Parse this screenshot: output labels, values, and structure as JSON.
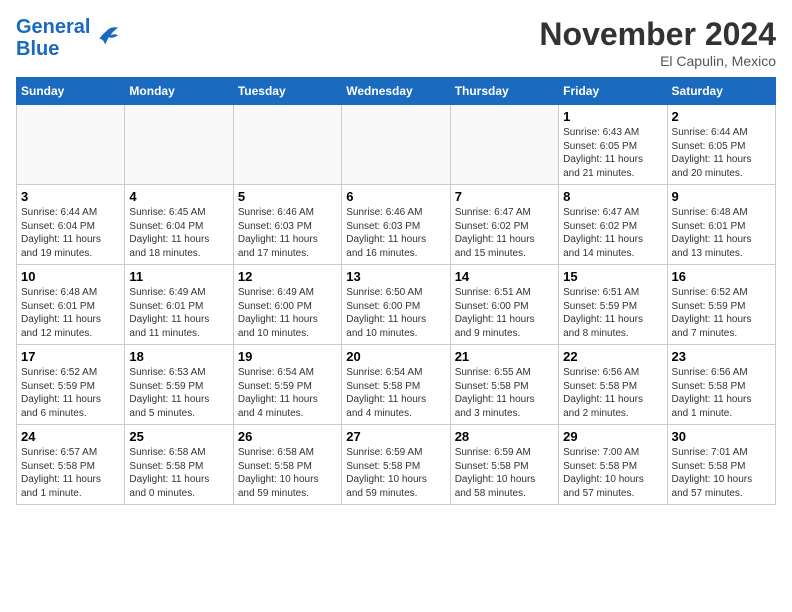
{
  "header": {
    "logo_line1": "General",
    "logo_line2": "Blue",
    "month": "November 2024",
    "location": "El Capulin, Mexico"
  },
  "weekdays": [
    "Sunday",
    "Monday",
    "Tuesday",
    "Wednesday",
    "Thursday",
    "Friday",
    "Saturday"
  ],
  "weeks": [
    [
      {
        "day": "",
        "info": ""
      },
      {
        "day": "",
        "info": ""
      },
      {
        "day": "",
        "info": ""
      },
      {
        "day": "",
        "info": ""
      },
      {
        "day": "",
        "info": ""
      },
      {
        "day": "1",
        "info": "Sunrise: 6:43 AM\nSunset: 6:05 PM\nDaylight: 11 hours\nand 21 minutes."
      },
      {
        "day": "2",
        "info": "Sunrise: 6:44 AM\nSunset: 6:05 PM\nDaylight: 11 hours\nand 20 minutes."
      }
    ],
    [
      {
        "day": "3",
        "info": "Sunrise: 6:44 AM\nSunset: 6:04 PM\nDaylight: 11 hours\nand 19 minutes."
      },
      {
        "day": "4",
        "info": "Sunrise: 6:45 AM\nSunset: 6:04 PM\nDaylight: 11 hours\nand 18 minutes."
      },
      {
        "day": "5",
        "info": "Sunrise: 6:46 AM\nSunset: 6:03 PM\nDaylight: 11 hours\nand 17 minutes."
      },
      {
        "day": "6",
        "info": "Sunrise: 6:46 AM\nSunset: 6:03 PM\nDaylight: 11 hours\nand 16 minutes."
      },
      {
        "day": "7",
        "info": "Sunrise: 6:47 AM\nSunset: 6:02 PM\nDaylight: 11 hours\nand 15 minutes."
      },
      {
        "day": "8",
        "info": "Sunrise: 6:47 AM\nSunset: 6:02 PM\nDaylight: 11 hours\nand 14 minutes."
      },
      {
        "day": "9",
        "info": "Sunrise: 6:48 AM\nSunset: 6:01 PM\nDaylight: 11 hours\nand 13 minutes."
      }
    ],
    [
      {
        "day": "10",
        "info": "Sunrise: 6:48 AM\nSunset: 6:01 PM\nDaylight: 11 hours\nand 12 minutes."
      },
      {
        "day": "11",
        "info": "Sunrise: 6:49 AM\nSunset: 6:01 PM\nDaylight: 11 hours\nand 11 minutes."
      },
      {
        "day": "12",
        "info": "Sunrise: 6:49 AM\nSunset: 6:00 PM\nDaylight: 11 hours\nand 10 minutes."
      },
      {
        "day": "13",
        "info": "Sunrise: 6:50 AM\nSunset: 6:00 PM\nDaylight: 11 hours\nand 10 minutes."
      },
      {
        "day": "14",
        "info": "Sunrise: 6:51 AM\nSunset: 6:00 PM\nDaylight: 11 hours\nand 9 minutes."
      },
      {
        "day": "15",
        "info": "Sunrise: 6:51 AM\nSunset: 5:59 PM\nDaylight: 11 hours\nand 8 minutes."
      },
      {
        "day": "16",
        "info": "Sunrise: 6:52 AM\nSunset: 5:59 PM\nDaylight: 11 hours\nand 7 minutes."
      }
    ],
    [
      {
        "day": "17",
        "info": "Sunrise: 6:52 AM\nSunset: 5:59 PM\nDaylight: 11 hours\nand 6 minutes."
      },
      {
        "day": "18",
        "info": "Sunrise: 6:53 AM\nSunset: 5:59 PM\nDaylight: 11 hours\nand 5 minutes."
      },
      {
        "day": "19",
        "info": "Sunrise: 6:54 AM\nSunset: 5:59 PM\nDaylight: 11 hours\nand 4 minutes."
      },
      {
        "day": "20",
        "info": "Sunrise: 6:54 AM\nSunset: 5:58 PM\nDaylight: 11 hours\nand 4 minutes."
      },
      {
        "day": "21",
        "info": "Sunrise: 6:55 AM\nSunset: 5:58 PM\nDaylight: 11 hours\nand 3 minutes."
      },
      {
        "day": "22",
        "info": "Sunrise: 6:56 AM\nSunset: 5:58 PM\nDaylight: 11 hours\nand 2 minutes."
      },
      {
        "day": "23",
        "info": "Sunrise: 6:56 AM\nSunset: 5:58 PM\nDaylight: 11 hours\nand 1 minute."
      }
    ],
    [
      {
        "day": "24",
        "info": "Sunrise: 6:57 AM\nSunset: 5:58 PM\nDaylight: 11 hours\nand 1 minute."
      },
      {
        "day": "25",
        "info": "Sunrise: 6:58 AM\nSunset: 5:58 PM\nDaylight: 11 hours\nand 0 minutes."
      },
      {
        "day": "26",
        "info": "Sunrise: 6:58 AM\nSunset: 5:58 PM\nDaylight: 10 hours\nand 59 minutes."
      },
      {
        "day": "27",
        "info": "Sunrise: 6:59 AM\nSunset: 5:58 PM\nDaylight: 10 hours\nand 59 minutes."
      },
      {
        "day": "28",
        "info": "Sunrise: 6:59 AM\nSunset: 5:58 PM\nDaylight: 10 hours\nand 58 minutes."
      },
      {
        "day": "29",
        "info": "Sunrise: 7:00 AM\nSunset: 5:58 PM\nDaylight: 10 hours\nand 57 minutes."
      },
      {
        "day": "30",
        "info": "Sunrise: 7:01 AM\nSunset: 5:58 PM\nDaylight: 10 hours\nand 57 minutes."
      }
    ]
  ]
}
